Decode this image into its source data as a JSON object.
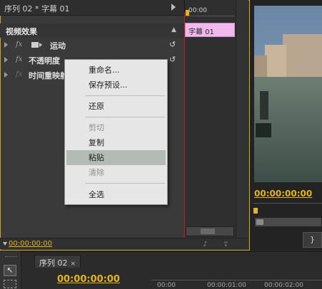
{
  "effect_controls": {
    "title": "序列 02 * 字幕 01",
    "section_header": "视频效果",
    "effects": [
      {
        "fx": "fx",
        "label": "运动",
        "has_icon": true
      },
      {
        "fx": "fx",
        "label": "不透明度"
      },
      {
        "fx": "fx",
        "label": "时间重映射"
      }
    ],
    "mini_timeline": {
      "time": "00:00",
      "clip_label": "字幕 01"
    },
    "footer_time": "00:00:00:00"
  },
  "context_menu": {
    "items": [
      {
        "label": "重命名...",
        "disabled": false
      },
      {
        "label": "保存预设...",
        "disabled": false
      },
      {
        "label": "还原",
        "disabled": false
      },
      {
        "label": "剪切",
        "disabled": true
      },
      {
        "label": "复制",
        "disabled": false
      },
      {
        "label": "粘贴",
        "disabled": false,
        "highlighted": true
      },
      {
        "label": "清除",
        "disabled": true
      },
      {
        "label": "全选",
        "disabled": false
      }
    ]
  },
  "program_monitor": {
    "time": "00:00:00:00",
    "button_label": "}"
  },
  "timeline": {
    "tab_label": "序列 02",
    "tab_close": "×",
    "time": "00:00:00:00",
    "ticks": [
      "00:00",
      "00:00:01:00",
      "00:00:02:00"
    ]
  },
  "colors": {
    "accent_timecode": "#e4b41e",
    "clip_pink": "#f0b8ec",
    "playhead_red": "#d01818",
    "menu_bg": "#e6e6e6",
    "menu_highlight": "#b4bab4"
  }
}
